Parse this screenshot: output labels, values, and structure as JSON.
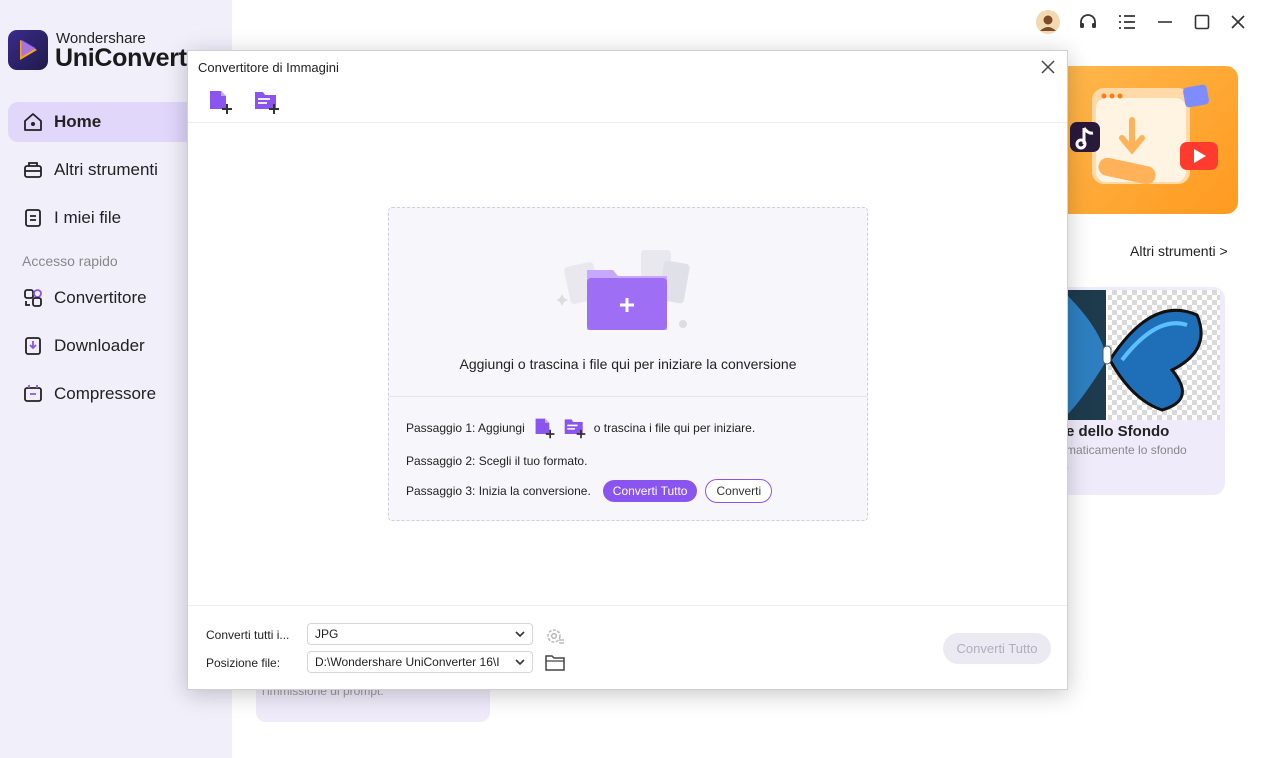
{
  "app": {
    "brand_small": "Wondershare",
    "brand_big": "UniConverter"
  },
  "sidebar": {
    "items": [
      {
        "label": "Home",
        "icon": "home-icon"
      },
      {
        "label": "Altri strumenti",
        "icon": "toolbox-icon"
      },
      {
        "label": "I miei file",
        "icon": "file-icon"
      }
    ],
    "section": "Accesso rapido",
    "quick": [
      {
        "label": "Convertitore",
        "icon": "converter-icon"
      },
      {
        "label": "Downloader",
        "icon": "downloader-icon"
      },
      {
        "label": "Compressore",
        "icon": "compressor-icon"
      }
    ]
  },
  "background": {
    "more_tools": "Altri strumenti >",
    "banner_url": "xxx.com",
    "card_title": "e dello Sfondo",
    "card_desc_1": "maticamente lo sfondo",
    "card_desc_2": ".",
    "prompt_text": "l'immissione di prompt."
  },
  "dialog": {
    "title": "Convertitore di Immagini",
    "drop_message": "Aggiungi o trascina i file qui per iniziare la conversione",
    "step1_prefix": "Passaggio 1: Aggiungi",
    "step1_suffix": "o trascina i file qui per iniziare.",
    "step2": "Passaggio 2: Scegli il tuo formato.",
    "step3": "Passaggio 3: Inizia la conversione.",
    "convert_all_pill": "Converti Tutto",
    "convert_pill": "Converti",
    "footer": {
      "format_label": "Converti tutti i...",
      "format_value": "JPG",
      "location_label": "Posizione file:",
      "location_value": "D:\\Wondershare UniConverter 16\\I",
      "convert_all_button": "Converti Tutto"
    }
  },
  "colors": {
    "accent": "#8a55ef",
    "sidebar_bg": "#f1effa",
    "active_bg": "#e0d7fb",
    "banner": "#ff9a1f"
  }
}
